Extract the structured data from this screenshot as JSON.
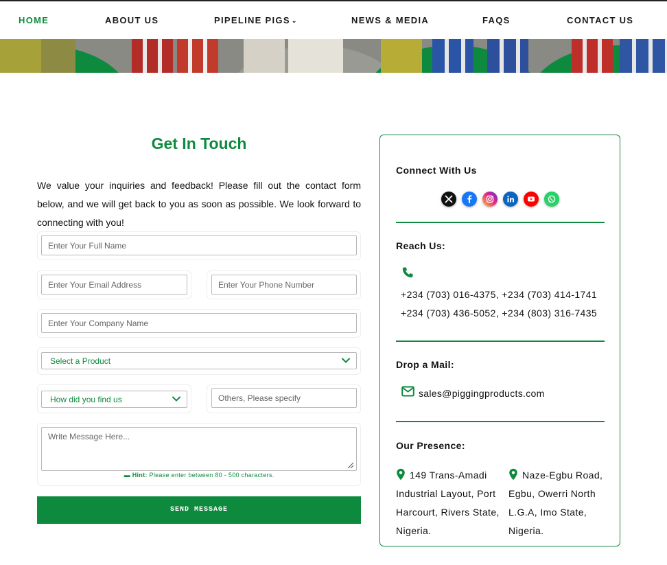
{
  "nav": {
    "items": [
      {
        "label": "HOME",
        "active": true
      },
      {
        "label": "ABOUT US"
      },
      {
        "label": "PIPELINE PIGS",
        "has_dropdown": true
      },
      {
        "label": "NEWS & MEDIA"
      },
      {
        "label": "FAQS"
      },
      {
        "label": "CONTACT US"
      }
    ]
  },
  "form": {
    "title": "Get In Touch",
    "intro": "We value your inquiries and feedback! Please fill out the contact form below, and we will get back to you as soon as possible. We look forward to connecting with you!",
    "full_name_placeholder": "Enter Your Full Name",
    "email_placeholder": "Enter Your Email Address",
    "phone_placeholder": "Enter Your Phone Number",
    "company_placeholder": "Enter Your Company Name",
    "product_select": "Select a Product",
    "source_select": "How did you find us",
    "others_placeholder": "Others, Please specify",
    "message_placeholder": "Write Message Here...",
    "hint_label": "Hint:",
    "hint_text": "Please enter between 80 - 500 characters.",
    "submit_label": "SEND MESSAGE"
  },
  "contact": {
    "connect_title": "Connect With Us",
    "social": [
      "x-icon",
      "facebook-icon",
      "instagram-icon",
      "linkedin-icon",
      "youtube-icon",
      "whatsapp-icon"
    ],
    "reach_title": "Reach Us:",
    "phones_line1": "+234 (703) 016-4375, +234 (703) 414-1741",
    "phones_line2": "+234 (703) 436-5052, +234 (803) 316-7435",
    "mail_title": "Drop a Mail:",
    "email": "sales@piggingproducts.com",
    "presence_title": "Our Presence:",
    "address1": "149 Trans-Amadi Industrial Layout, Port Harcourt, Rivers State, Nigeria.",
    "address2": "Naze-Egbu Road, Egbu, Owerri North L.G.A, Imo State, Nigeria."
  },
  "colors": {
    "brand_green": "#0e8a3e",
    "facebook": "#1877f2",
    "instagram": "#e1306c",
    "linkedin": "#0a66c2",
    "youtube": "#ff0000",
    "whatsapp": "#25d366"
  }
}
